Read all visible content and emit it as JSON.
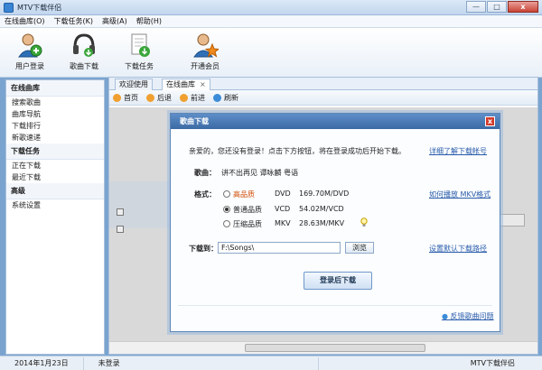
{
  "window": {
    "title": "MTV下载伴侣",
    "min_label": "—",
    "max_label": "□",
    "close_label": "x"
  },
  "menu": [
    "在线曲库(O)",
    "下载任务(K)",
    "高级(A)",
    "帮助(H)"
  ],
  "toolbar": [
    {
      "label": "用户登录",
      "icon": "user-login-icon"
    },
    {
      "label": "歌曲下载",
      "icon": "headphones-icon"
    },
    {
      "label": "下载任务",
      "icon": "download-task-icon"
    },
    {
      "label": "开通会员",
      "icon": "vip-member-icon"
    }
  ],
  "sidebar": {
    "sections": [
      {
        "title": "在线曲库",
        "items": [
          "搜索歌曲",
          "曲库导航",
          "下载排行",
          "新歌速递"
        ]
      },
      {
        "title": "下载任务",
        "items": [
          "正在下载",
          "最近下载"
        ]
      },
      {
        "title": "高级",
        "items": [
          "系统设置"
        ]
      }
    ]
  },
  "tabs": [
    {
      "label": "欢迎使用"
    },
    {
      "label": "在线曲库",
      "close": "×"
    }
  ],
  "nav": [
    "首页",
    "后退",
    "前进",
    "刷新"
  ],
  "dialog": {
    "title": "歌曲下载",
    "close": "x",
    "notice": "亲爱的，您还没有登录！点击下方按钮，将在登录成功后开始下载。",
    "learn_more": "详细了解下载帐号",
    "song_label": "歌曲：",
    "song_value": "讲不出再见  谭咏麟  粤语",
    "format_label": "格式：",
    "formats": [
      {
        "name": "高品质",
        "type": "DVD",
        "size": "169.70M/DVD",
        "selected": false
      },
      {
        "name": "普通品质",
        "type": "VCD",
        "size": "54.02M/VCD",
        "selected": true
      },
      {
        "name": "压缩品质",
        "type": "MKV",
        "size": "28.63M/MKV",
        "selected": false
      }
    ],
    "format_help": "如何播放 MKV格式",
    "download_to_label": "下载到：",
    "path": "F:\\Songs\\",
    "browse": "浏览",
    "default_path_link": "设置默认下载路径",
    "login_button": "登录后下载",
    "feedback": "反馈歌曲问题"
  },
  "status": {
    "date": "2014年1月23日",
    "login": "未登录",
    "app": "MTV下载伴侣"
  },
  "colors": {
    "accent": "#3b6aa5",
    "background": "#7aa4cf"
  }
}
